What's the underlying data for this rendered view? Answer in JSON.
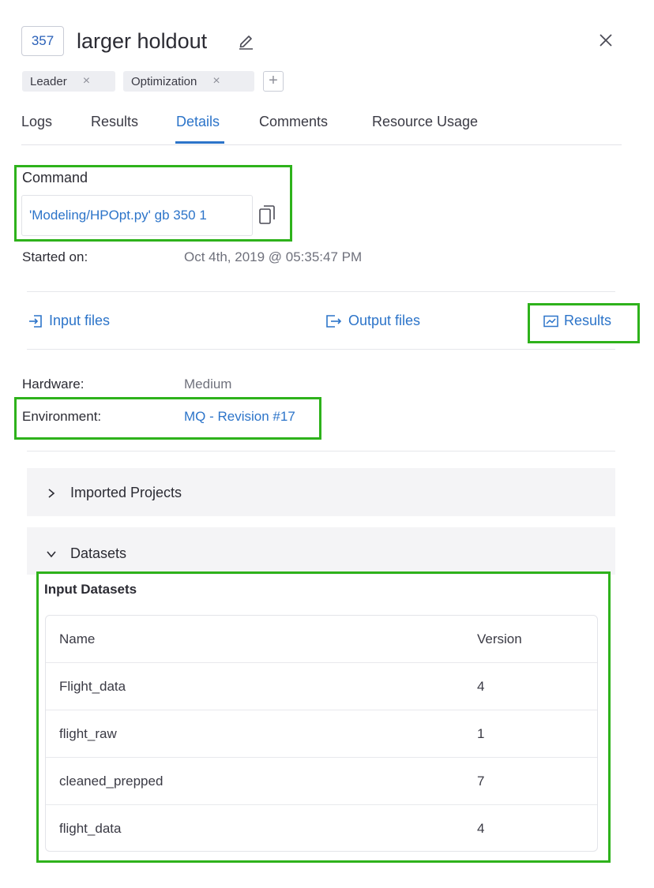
{
  "header": {
    "run_id": "357",
    "title": "larger holdout"
  },
  "tags": [
    {
      "label": "Leader"
    },
    {
      "label": "Optimization"
    }
  ],
  "tag_add_label": "+",
  "tabs": [
    {
      "label": "Logs"
    },
    {
      "label": "Results"
    },
    {
      "label": "Details",
      "active": true
    },
    {
      "label": "Comments"
    },
    {
      "label": "Resource Usage"
    }
  ],
  "command": {
    "label": "Command",
    "value": "'Modeling/HPOpt.py' gb 350 1"
  },
  "started": {
    "label": "Started on:",
    "value": "Oct 4th, 2019 @ 05:35:47 PM"
  },
  "file_links": {
    "input": "Input files",
    "output": "Output files",
    "results": "Results"
  },
  "hardware": {
    "label": "Hardware:",
    "value": "Medium"
  },
  "environment": {
    "label": "Environment:",
    "value": "MQ - Revision #17"
  },
  "sections": {
    "imported_projects": "Imported Projects",
    "datasets": "Datasets"
  },
  "input_datasets": {
    "label": "Input Datasets",
    "columns": [
      "Name",
      "Version"
    ],
    "rows": [
      {
        "name": "Flight_data",
        "version": "4"
      },
      {
        "name": "flight_raw",
        "version": "1"
      },
      {
        "name": "cleaned_prepped",
        "version": "7"
      },
      {
        "name": "flight_data",
        "version": "4"
      }
    ]
  },
  "colors": {
    "accent": "#2c74c9",
    "highlight": "#2eb21b"
  }
}
